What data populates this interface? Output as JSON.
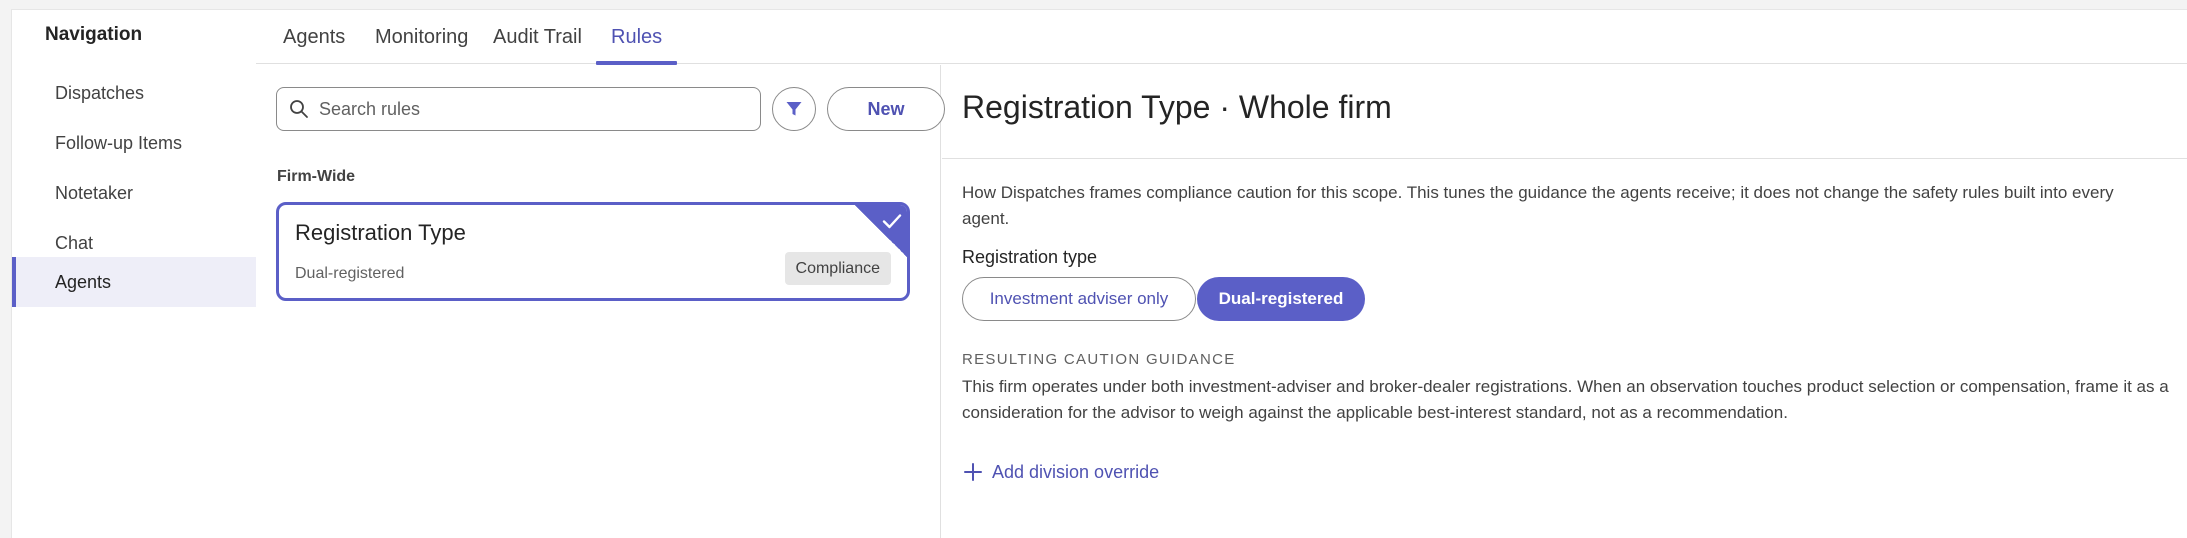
{
  "sidebar": {
    "title": "Navigation",
    "items": [
      {
        "label": "Dispatches"
      },
      {
        "label": "Follow-up Items"
      },
      {
        "label": "Notetaker"
      },
      {
        "label": "Chat"
      },
      {
        "label": "Agents",
        "active": true
      }
    ]
  },
  "tabs": [
    {
      "label": "Agents"
    },
    {
      "label": "Monitoring"
    },
    {
      "label": "Audit Trail"
    },
    {
      "label": "Rules",
      "active": true
    }
  ],
  "list": {
    "search_placeholder": "Search rules",
    "filter_icon": "filter-icon",
    "new_label": "New",
    "section_label": "Firm-Wide",
    "cards": [
      {
        "title": "Registration Type",
        "subtitle": "Dual-registered",
        "badge": "Compliance",
        "selected": true
      }
    ]
  },
  "detail": {
    "title": "Registration Type · Whole firm",
    "description": "How Dispatches frames compliance caution for this scope. This tunes the guidance the agents receive; it does not change the safety rules built into every agent.",
    "field_label": "Registration type",
    "options": [
      {
        "label": "Investment adviser only",
        "selected": false
      },
      {
        "label": "Dual-registered",
        "selected": true
      }
    ],
    "result_label": "RESULTING CAUTION GUIDANCE",
    "result_text": "This firm operates under both investment-adviser and broker-dealer registrations. When an observation touches product selection or compensation, frame it as a consideration for the advisor to weigh against the applicable best-interest standard, not as a recommendation.",
    "add_override_label": "Add division override"
  },
  "colors": {
    "accent": "#5b5fc7",
    "accent_text": "#4f52b2",
    "active_nav_bg": "#eeeef8"
  }
}
